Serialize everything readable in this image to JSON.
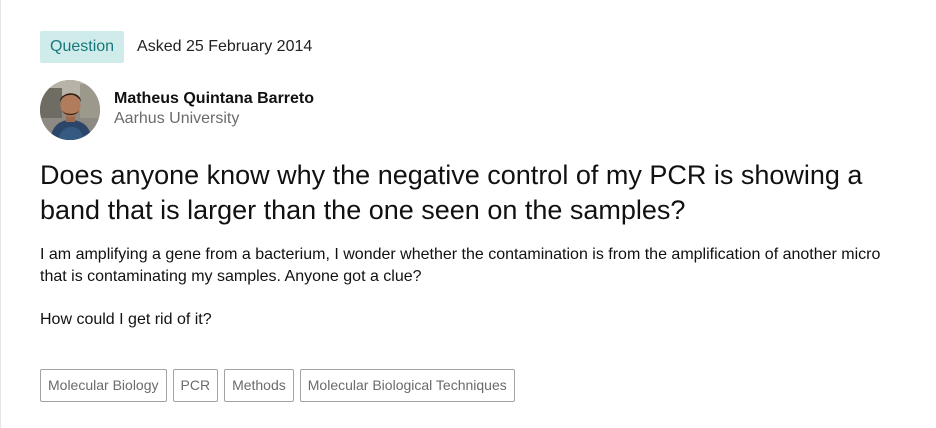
{
  "question": {
    "badge": "Question",
    "asked": "Asked 25 February 2014",
    "author": {
      "name": "Matheus Quintana Barreto",
      "institution": "Aarhus University"
    },
    "title": "Does anyone know why the negative control of my PCR is showing a band that is larger than the one seen on the samples?",
    "body": [
      "I am amplifying a gene from a bacterium, I wonder whether the contamination is from the amplification of another micro that is contaminating my samples. Anyone got a clue?",
      "How could I get rid of it?"
    ],
    "tags": [
      "Molecular Biology",
      "PCR",
      "Methods",
      "Molecular Biological Techniques"
    ]
  },
  "colors": {
    "badge_bg": "#cfeceb",
    "badge_text": "#16777a",
    "muted_text": "#6b6b6b",
    "tag_border": "#a3a3a3"
  }
}
